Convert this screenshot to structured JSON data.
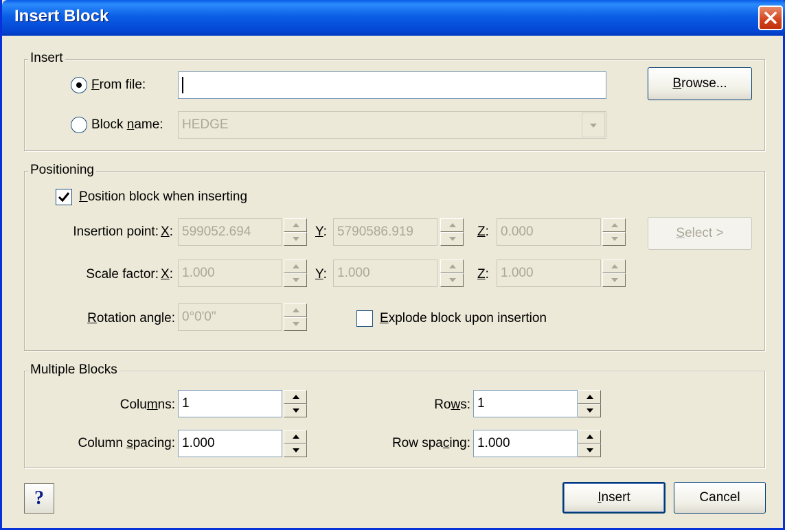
{
  "window": {
    "title": "Insert Block"
  },
  "insert": {
    "group_label": "Insert",
    "from_file": {
      "label_before": "",
      "mnemonic": "F",
      "label_after": "rom file:",
      "value": "",
      "selected": true
    },
    "block_name": {
      "label_before": "Block ",
      "mnemonic": "n",
      "label_after": "ame:",
      "value": "HEDGE",
      "selected": false
    },
    "browse_button": {
      "mnemonic": "B",
      "rest": "rowse..."
    }
  },
  "positioning": {
    "group_label": "Positioning",
    "position_checkbox": {
      "mnemonic": "P",
      "rest": "osition block when inserting",
      "checked": true
    },
    "insertion_point": {
      "label": "Insertion point:",
      "x": "599052.694",
      "y": "5790586.919",
      "z": "0.000"
    },
    "scale_factor": {
      "label": "Scale factor:",
      "x": "1.000",
      "y": "1.000",
      "z": "1.000"
    },
    "rotation": {
      "mnemonic": "R",
      "rest": "otation angle:",
      "value": "0°0'0\""
    },
    "select_button": {
      "mnemonic": "S",
      "rest": "elect >"
    },
    "explode_checkbox": {
      "mnemonic": "E",
      "rest": "xplode block upon insertion",
      "checked": false
    },
    "axis": {
      "x": "X",
      "y": "Y",
      "z": "Z"
    }
  },
  "multiple": {
    "group_label": "Multiple Blocks",
    "columns": {
      "before": "Colu",
      "mnemonic": "m",
      "after": "ns:",
      "value": "1"
    },
    "rows": {
      "before": "Ro",
      "mnemonic": "w",
      "after": "s:",
      "value": "1"
    },
    "column_spacing": {
      "before": "Column ",
      "mnemonic": "s",
      "after": "pacing:",
      "value": "1.000"
    },
    "row_spacing": {
      "before": "Row spa",
      "mnemonic": "c",
      "after": "ing:",
      "value": "1.000"
    }
  },
  "footer": {
    "help": "?",
    "insert_button": {
      "mnemonic": "I",
      "rest": "nsert"
    },
    "cancel_button": "Cancel"
  }
}
